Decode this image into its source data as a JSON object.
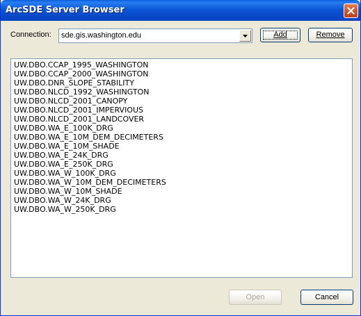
{
  "window": {
    "title": "ArcSDE Server Browser"
  },
  "connection": {
    "label": "Connection:",
    "value": "sde.gis.washington.edu",
    "add_label": "Add",
    "remove_label": "Remove"
  },
  "layers": [
    "UW.DBO.CCAP_1995_WASHINGTON",
    "UW.DBO.CCAP_2000_WASHINGTON",
    "UW.DBO.DNR_SLOPE_STABILITY",
    "UW.DBO.NLCD_1992_WASHINGTON",
    "UW.DBO.NLCD_2001_CANOPY",
    "UW.DBO.NLCD_2001_IMPERVIOUS",
    "UW.DBO.NLCD_2001_LANDCOVER",
    "UW.DBO.WA_E_100K_DRG",
    "UW.DBO.WA_E_10M_DEM_DECIMETERS",
    "UW.DBO.WA_E_10M_SHADE",
    "UW.DBO.WA_E_24K_DRG",
    "UW.DBO.WA_E_250K_DRG",
    "UW.DBO.WA_W_100K_DRG",
    "UW.DBO.WA_W_10M_DEM_DECIMETERS",
    "UW.DBO.WA_W_10M_SHADE",
    "UW.DBO.WA_W_24K_DRG",
    "UW.DBO.WA_W_250K_DRG"
  ],
  "footer": {
    "open_label": "Open",
    "open_enabled": false,
    "cancel_label": "Cancel"
  },
  "icons": {
    "close": "close-icon",
    "dropdown": "chevron-down-icon"
  },
  "colors": {
    "title_bar": "#0b57d6",
    "dialog_bg": "#ece9d8",
    "close_button": "#d2552a",
    "disabled_text": "#aca899"
  }
}
